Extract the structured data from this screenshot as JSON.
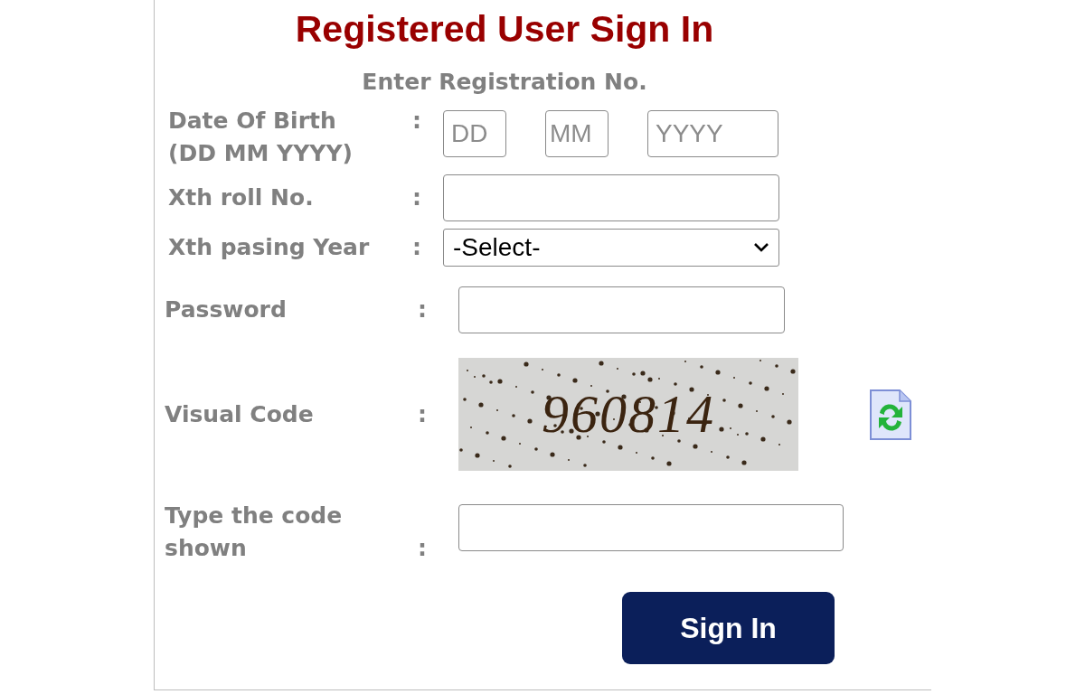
{
  "title": "Registered User Sign In",
  "subtitle": "Enter Registration No.",
  "fields": [
    {
      "kind": "date",
      "label": "Date Of Birth",
      "sublabel": "(DD MM YYYY)",
      "colon": ":",
      "parts": [
        {
          "placeholder": "DD"
        },
        {
          "placeholder": "MM"
        },
        {
          "placeholder": "YYYY"
        }
      ]
    },
    {
      "kind": "text",
      "label": "Xth roll No.",
      "colon": ":"
    },
    {
      "kind": "select",
      "label": "Xth pasing Year",
      "colon": ":",
      "value": "-Select-"
    },
    {
      "kind": "password",
      "label": "Password",
      "colon": ":"
    },
    {
      "kind": "captcha",
      "label": "Visual Code",
      "colon": ":",
      "code": "960814"
    },
    {
      "kind": "code",
      "label": "Type the code shown",
      "colon": ":"
    }
  ],
  "button": "Sign In"
}
